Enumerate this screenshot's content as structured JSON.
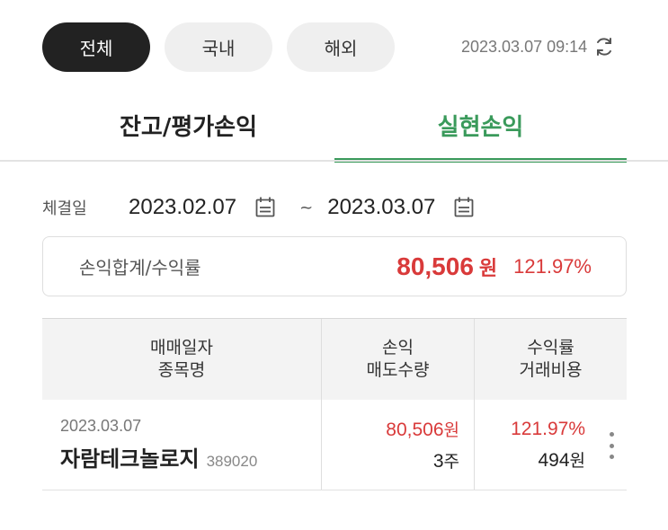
{
  "filters": {
    "all": "전체",
    "domestic": "국내",
    "overseas": "해외",
    "active": "all"
  },
  "timestamp": "2023.03.07 09:14",
  "tabs": {
    "balance": "잔고/평가손익",
    "realized": "실현손익",
    "active": "realized"
  },
  "date_filter": {
    "label": "체결일",
    "start": "2023.02.07",
    "separator": "~",
    "end": "2023.03.07"
  },
  "summary": {
    "label": "손익합계/수익률",
    "amount": "80,506",
    "amount_unit": "원",
    "rate": "121.97%"
  },
  "table": {
    "headers": {
      "col1_line1": "매매일자",
      "col1_line2": "종목명",
      "col2_line1": "손익",
      "col2_line2": "매도수량",
      "col3_line1": "수익률",
      "col3_line2": "거래비용"
    },
    "rows": [
      {
        "date": "2023.03.07",
        "name": "자람테크놀로지",
        "code": "389020",
        "profit": "80,506",
        "profit_unit": "원",
        "qty": "3",
        "qty_unit": "주",
        "rate": "121.97%",
        "cost": "494",
        "cost_unit": "원"
      }
    ]
  },
  "colors": {
    "accent": "#3a9a5b",
    "profit": "#d93a3a",
    "chip_active": "#222222",
    "chip_inactive": "#efefef"
  },
  "icons": {
    "refresh": "refresh-icon",
    "calendar": "calendar-icon",
    "more": "more-vertical-icon"
  }
}
